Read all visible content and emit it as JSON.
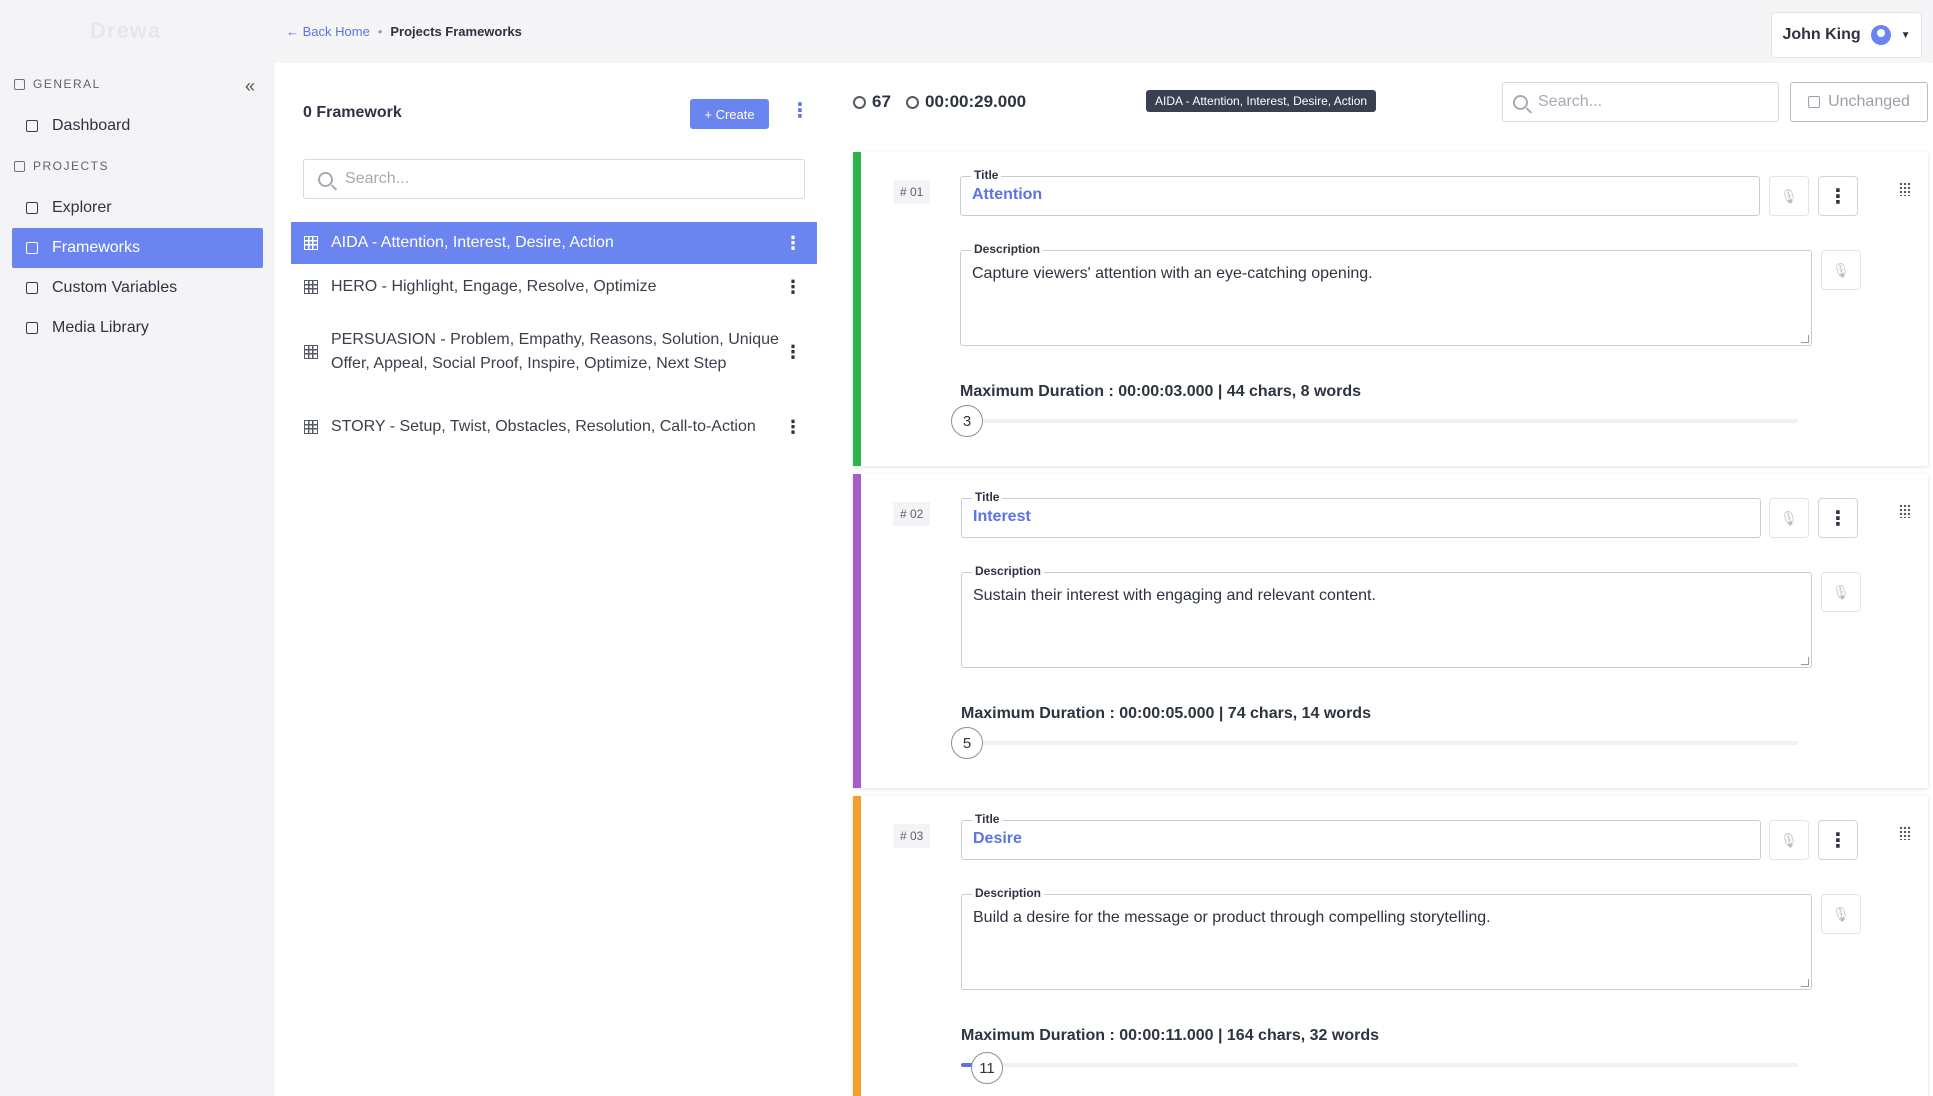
{
  "app": {
    "logo_text": "Drewa"
  },
  "sidebar": {
    "section_general": "GENERAL",
    "section_projects": "PROJECTS",
    "items": [
      {
        "label": "Dashboard",
        "icon": "dashboard-icon"
      },
      {
        "label": "Explorer",
        "icon": "explorer-icon"
      },
      {
        "label": "Frameworks",
        "icon": "frameworks-icon",
        "active": true
      },
      {
        "label": "Custom Variables",
        "icon": "variables-icon"
      },
      {
        "label": "Media Library",
        "icon": "media-icon"
      }
    ]
  },
  "breadcrumb": {
    "back": "← Back Home",
    "current": "Projects Frameworks"
  },
  "user": {
    "name": "John King"
  },
  "frameworks_panel": {
    "count_label": "0 Framework",
    "create_label": "+ Create",
    "search_placeholder": "Search...",
    "items": [
      {
        "label": "AIDA - Attention, Interest, Desire, Action",
        "active": true
      },
      {
        "label": "HERO - Highlight, Engage, Resolve, Optimize"
      },
      {
        "label": "PERSUASION - Problem, Empathy, Reasons, Solution, Unique Offer, Appeal, Social Proof, Inspire, Optimize, Next Step"
      },
      {
        "label": "STORY - Setup, Twist, Obstacles, Resolution, Call-to-Action"
      }
    ]
  },
  "editor": {
    "score": "67",
    "total_duration": "00:00:29.000",
    "selected_tag": "AIDA - Attention, Interest, Desire, Action",
    "search_placeholder": "Search...",
    "status_label": "Unchanged",
    "title_legend": "Title",
    "description_legend": "Description",
    "cards": [
      {
        "num": "# 01",
        "color": "#2fb34c",
        "title": "Attention",
        "description": "Capture viewers' attention with an eye-catching opening.",
        "max_duration": "Maximum Duration : 00:00:03.000 | 44 chars, 8 words",
        "slider_value": "3",
        "slider_fraction": 0.0
      },
      {
        "num": "# 02",
        "color": "#a35fc7",
        "title": "Interest",
        "description": "Sustain their interest with engaging and relevant content.",
        "max_duration": "Maximum Duration : 00:00:05.000 | 74 chars, 14 words",
        "slider_value": "5",
        "slider_fraction": 0.0
      },
      {
        "num": "# 03",
        "color": "#f1a02a",
        "title": "Desire",
        "description": "Build a desire for the message or product through compelling storytelling.",
        "max_duration": "Maximum Duration : 00:00:11.000 | 164 chars, 32 words",
        "slider_value": "11",
        "slider_fraction": 0.04
      }
    ]
  }
}
